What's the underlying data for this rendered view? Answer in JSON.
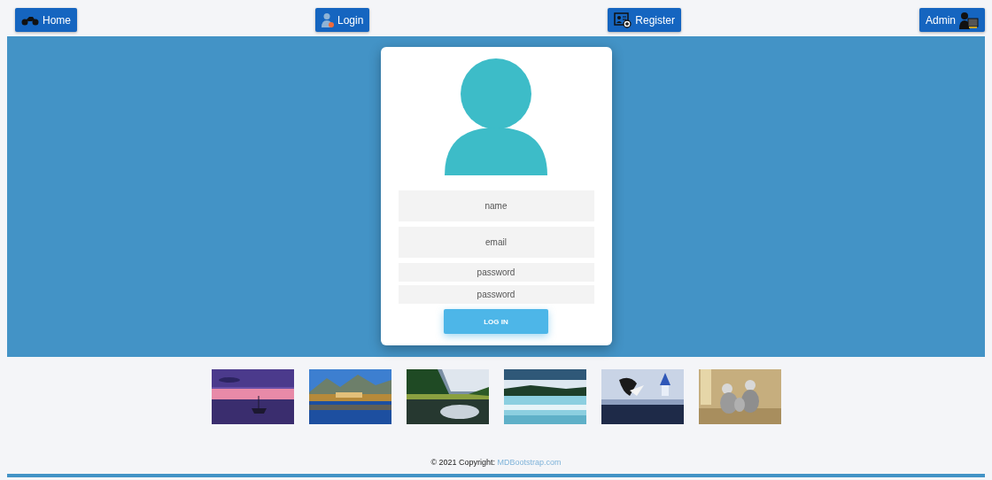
{
  "nav": {
    "buttons": [
      {
        "label": "Home",
        "kind": "home"
      },
      {
        "label": "Login",
        "kind": "login"
      },
      {
        "label": "Register",
        "kind": "register"
      },
      {
        "label": "Admin",
        "kind": "admin"
      }
    ]
  },
  "login_card": {
    "fields": [
      {
        "placeholder": "name",
        "kind": "tall"
      },
      {
        "placeholder": "email",
        "kind": "tall"
      },
      {
        "placeholder": "password",
        "kind": "short"
      },
      {
        "placeholder": "password",
        "kind": "short"
      }
    ],
    "button": "LOG IN"
  },
  "footer": {
    "text": "© 2021 Copyright:",
    "link": "MDBootstrap.com"
  }
}
